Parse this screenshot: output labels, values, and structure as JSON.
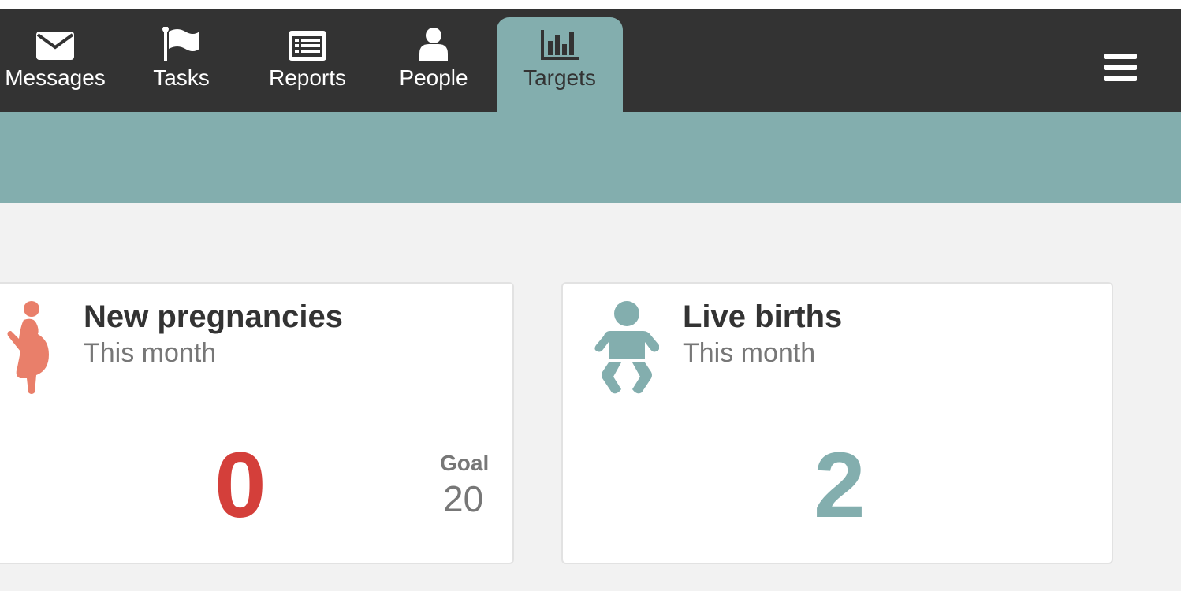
{
  "nav": {
    "tabs": [
      {
        "label": "Messages",
        "icon": "envelope-icon"
      },
      {
        "label": "Tasks",
        "icon": "flag-icon"
      },
      {
        "label": "Reports",
        "icon": "list-icon"
      },
      {
        "label": "People",
        "icon": "person-icon"
      },
      {
        "label": "Targets",
        "icon": "bar-chart-icon",
        "active": true
      }
    ],
    "menu_icon": "hamburger-icon"
  },
  "colors": {
    "navbar": "#333333",
    "accent": "#83aeae",
    "pregnancy_icon": "#e97f6a",
    "pregnancy_count": "#d43f3a",
    "births": "#83aeae"
  },
  "targets": [
    {
      "title": "New pregnancies",
      "subtitle": "This month",
      "value": "0",
      "goal_label": "Goal",
      "goal_value": "20",
      "icon": "pregnant-woman-icon"
    },
    {
      "title": "Live births",
      "subtitle": "This month",
      "value": "2",
      "icon": "baby-icon"
    }
  ]
}
